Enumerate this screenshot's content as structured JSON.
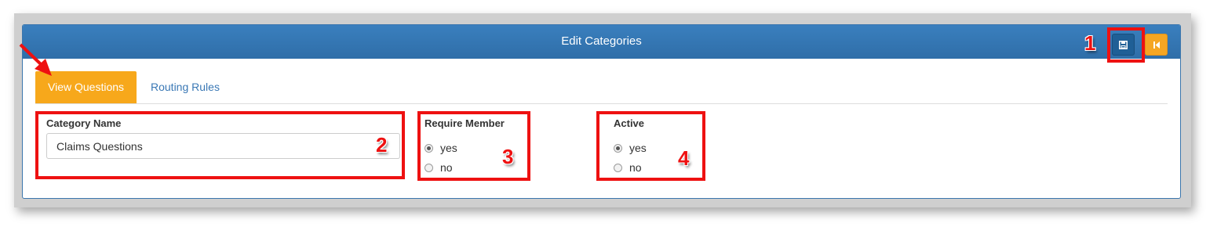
{
  "header": {
    "title": "Edit Categories"
  },
  "toolbar": {
    "save_icon": "save-icon",
    "back_icon": "skip-back-icon"
  },
  "tabs": [
    {
      "label": "View Questions",
      "active": true
    },
    {
      "label": "Routing Rules",
      "active": false
    }
  ],
  "form": {
    "category_name": {
      "label": "Category Name",
      "value": "Claims Questions"
    },
    "require_member": {
      "label": "Require Member",
      "options": [
        {
          "label": "yes",
          "checked": true
        },
        {
          "label": "no",
          "checked": false
        }
      ]
    },
    "active": {
      "label": "Active",
      "options": [
        {
          "label": "yes",
          "checked": true
        },
        {
          "label": "no",
          "checked": false
        }
      ]
    }
  },
  "annotations": {
    "one": "1",
    "two": "2",
    "three": "3",
    "four": "4"
  },
  "colors": {
    "header": "#3a7fbe",
    "tab_active": "#f7a81b",
    "save_button": "#1f5f96",
    "back_button": "#f5a623",
    "annotation": "#ee1111",
    "link": "#3a78b5"
  }
}
